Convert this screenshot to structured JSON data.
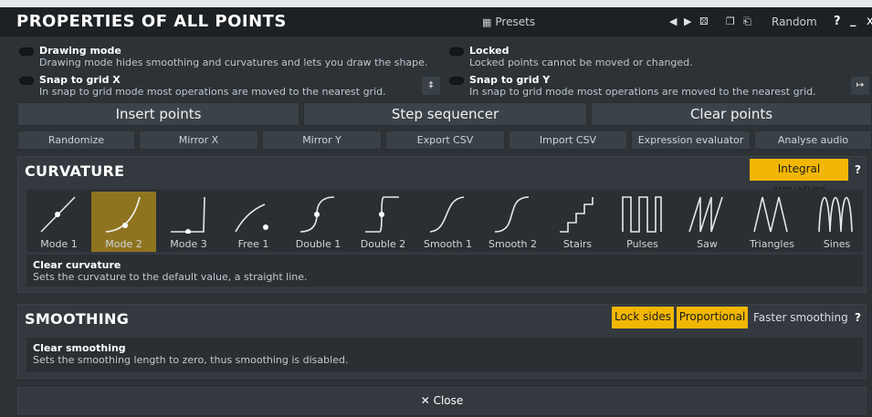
{
  "window": {
    "title": "PROPERTIES OF ALL POINTS",
    "presets_label": "Presets",
    "random_label": "Random",
    "help_label": "?",
    "minimize_label": "_",
    "close_label": "x"
  },
  "options": {
    "drawing_mode": {
      "label": "Drawing mode",
      "desc": "Drawing mode hides smoothing and curvatures and lets you draw the shape."
    },
    "locked": {
      "label": "Locked",
      "desc": "Locked points cannot be moved or changed."
    },
    "snap_x": {
      "label": "Snap to grid X",
      "desc": "In snap to grid mode most operations are moved to the nearest grid."
    },
    "snap_y": {
      "label": "Snap to grid Y",
      "desc": "In snap to grid mode most operations are moved to the nearest grid."
    }
  },
  "actions": {
    "insert_points": "Insert points",
    "step_sequencer": "Step sequencer",
    "clear_points": "Clear points"
  },
  "tools": [
    "Randomize",
    "Mirror X",
    "Mirror Y",
    "Export CSV",
    "Import CSV",
    "Expression evaluator",
    "Analyse audio"
  ],
  "curvature": {
    "title": "CURVATURE",
    "integral_label": "Integral curvature",
    "help": "?",
    "selected": "Mode 2",
    "modes": [
      "Mode 1",
      "Mode 2",
      "Mode 3",
      "Free 1",
      "Double 1",
      "Double 2",
      "Smooth 1",
      "Smooth 2",
      "Stairs",
      "Pulses",
      "Saw",
      "Triangles",
      "Sines"
    ],
    "info_title": "Clear curvature",
    "info_desc": "Sets the curvature to the default value, a straight line."
  },
  "smoothing": {
    "title": "SMOOTHING",
    "lock_sides": "Lock sides",
    "proportional": "Proportional",
    "faster": "Faster smoothing",
    "help": "?",
    "info_title": "Clear smoothing",
    "info_desc": "Sets the smoothing length to zero, thus smoothing is disabled."
  },
  "close_button": "✕ Close",
  "colors": {
    "accent": "#f2b705",
    "selected_mode": "#8f7420",
    "background": "#2c3236"
  }
}
